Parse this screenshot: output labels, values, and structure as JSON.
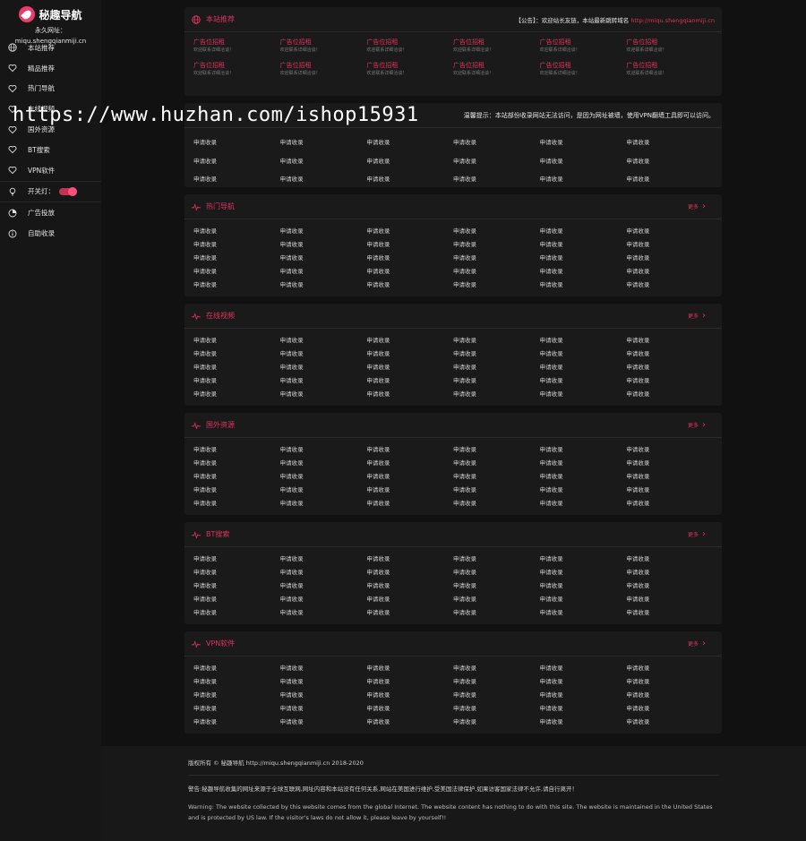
{
  "site": {
    "logo_text": "秘趣导航",
    "perm_url_label": "永久网址：miqu.shengqianmiji.cn"
  },
  "sidebar": {
    "items": [
      {
        "label": "本站推荐",
        "icon": "globe-icon"
      },
      {
        "label": "精品推荐",
        "icon": "heart-icon"
      },
      {
        "label": "热门导航",
        "icon": "heart-icon"
      },
      {
        "label": "在线视频",
        "icon": "heart-icon"
      },
      {
        "label": "国外资源",
        "icon": "heart-icon"
      },
      {
        "label": "BT搜索",
        "icon": "heart-icon"
      },
      {
        "label": "VPN软件",
        "icon": "heart-icon"
      }
    ],
    "toggle_label": "开关灯：",
    "extra": [
      {
        "label": "广告投放",
        "icon": "pie-chart-icon"
      },
      {
        "label": "自助收录",
        "icon": "info-icon"
      }
    ]
  },
  "recommend": {
    "title": "本站推荐",
    "notice_prefix": "【公告】：欢迎站长友链，本站最新跳转域名 ",
    "notice_url": "http://miqu.shengqianmiji.cn",
    "ads": [
      {
        "title": "广告位招租",
        "sub": "欢迎联系详细洽谈！"
      },
      {
        "title": "广告位招租",
        "sub": "欢迎联系详细洽谈！"
      },
      {
        "title": "广告位招租",
        "sub": "欢迎联系详细洽谈！"
      },
      {
        "title": "广告位招租",
        "sub": "欢迎联系详细洽谈！"
      },
      {
        "title": "广告位招租",
        "sub": "欢迎联系详细洽谈！"
      },
      {
        "title": "广告位招租",
        "sub": "欢迎联系详细洽谈！"
      },
      {
        "title": "广告位招租",
        "sub": "欢迎联系详细洽谈！"
      },
      {
        "title": "广告位招租",
        "sub": "欢迎联系详细洽谈！"
      },
      {
        "title": "广告位招租",
        "sub": "欢迎联系详细洽谈！"
      },
      {
        "title": "广告位招租",
        "sub": "欢迎联系详细洽谈！"
      },
      {
        "title": "广告位招租",
        "sub": "欢迎联系详细洽谈！"
      },
      {
        "title": "广告位招租",
        "sub": "欢迎联系详细洽谈！"
      }
    ]
  },
  "included": {
    "tip": "温馨提示：本站部份收录网站无法访问，是因为网址被墙，使用VPN翻墙工具即可以访问。",
    "link_label": "申请收录",
    "rows": 3
  },
  "sections": [
    {
      "title": "热门导航",
      "more": "更多"
    },
    {
      "title": "在线视频",
      "more": "更多"
    },
    {
      "title": "国外资源",
      "more": "更多"
    },
    {
      "title": "BT搜索",
      "more": "更多"
    },
    {
      "title": "VPN软件",
      "more": "更多"
    }
  ],
  "section_link_label": "申请收录",
  "section_rows": 5,
  "footer": {
    "copyright": "版权所有 © 秘趣导航 http://miqu.shengqianmiji.cn 2018-2020",
    "warning_cn": "警告:秘趣导航收集的网址来源于全球互联网,网址内容和本站没有任何关系,网站在美国进行维护,受美国法律保护,如果访客国家法律不允许,请自行离开！",
    "warning_en": "Warning: The website collected by this website comes from the global Internet. The website content has nothing to do with this site. The website is maintained in the United States and is protected by US law. If the visitor's laws do not allow it, please leave by yourself!!"
  },
  "watermark": "https://www.huzhan.com/ishop15931",
  "colors": {
    "accent": "#e0325f",
    "bg": "#111111",
    "card": "#1a1a1a"
  }
}
